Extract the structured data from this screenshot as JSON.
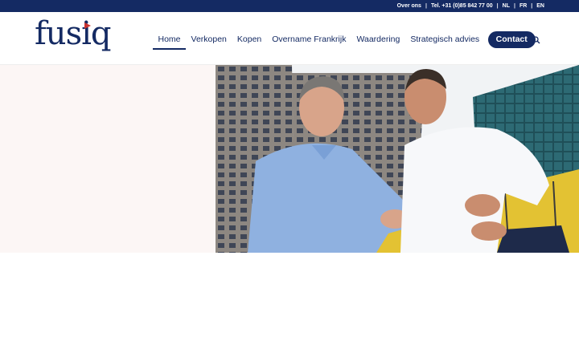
{
  "topbar": {
    "about": "Over ons",
    "phone": "Tel. +31 (0)85 842 77 00",
    "languages": [
      "NL",
      "FR",
      "EN"
    ]
  },
  "header": {
    "logo_text": "fusiq",
    "nav": [
      {
        "label": "Home",
        "active": true
      },
      {
        "label": "Verkopen"
      },
      {
        "label": "Kopen"
      },
      {
        "label": "Overname Frankrijk"
      },
      {
        "label": "Waardering"
      },
      {
        "label": "Strategisch advies"
      }
    ],
    "contact_label": "Contact",
    "search_icon": "search-icon"
  },
  "colors": {
    "brand_navy": "#142a63",
    "logo_accent": "#c9322f",
    "hero_bg": "#fcf6f5"
  }
}
